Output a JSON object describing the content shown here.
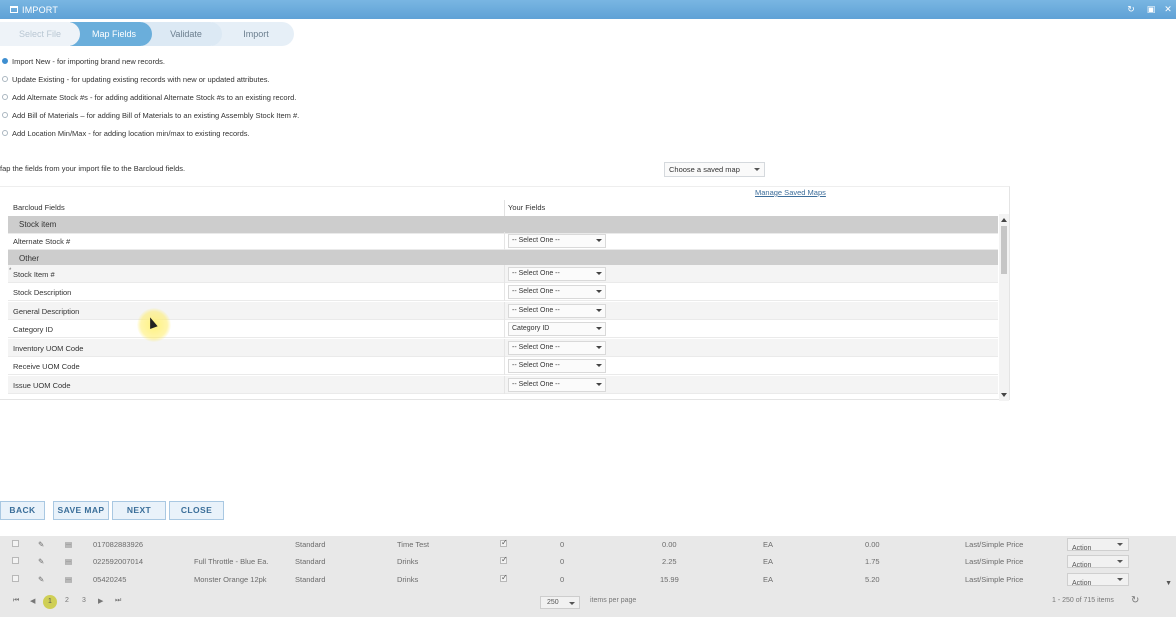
{
  "window": {
    "title": "IMPORT"
  },
  "steps": [
    "Select File",
    "Map Fields",
    "Validate",
    "Import"
  ],
  "options": [
    {
      "label": "Import New - for importing brand new records.",
      "checked": true
    },
    {
      "label": "Update Existing - for updating existing records with new or updated attributes.",
      "checked": false
    },
    {
      "label": "Add Alternate Stock #s - for adding additional Alternate Stock #s to an existing record.",
      "checked": false
    },
    {
      "label": "Add Bill of Materials – for adding Bill of Materials to an existing Assembly Stock Item #.",
      "checked": false
    },
    {
      "label": "Add Location Min/Max - for adding location min/max to existing records.",
      "checked": false
    }
  ],
  "map_instruction": "fap the fields from your import file to the Barcloud fields.",
  "saved_map": "Choose a saved map",
  "manage_link": "Manage Saved Maps",
  "grid": {
    "headers": [
      "Barcloud Fields",
      "Your Fields"
    ],
    "rows": [
      {
        "type": "group",
        "name": "Stock item"
      },
      {
        "type": "field",
        "name": "Alternate Stock #",
        "value": "-- Select One --"
      },
      {
        "type": "group",
        "name": "Other"
      },
      {
        "type": "field",
        "name": "Stock Item #",
        "value": "-- Select One --",
        "required": true
      },
      {
        "type": "field",
        "name": "Stock Description",
        "value": "-- Select One --"
      },
      {
        "type": "field",
        "name": "General Description",
        "value": "-- Select One --"
      },
      {
        "type": "field",
        "name": "Category ID",
        "value": "Category ID"
      },
      {
        "type": "field",
        "name": "Inventory UOM Code",
        "value": "-- Select One --"
      },
      {
        "type": "field",
        "name": "Receive UOM Code",
        "value": "-- Select One --"
      },
      {
        "type": "field",
        "name": "Issue UOM Code",
        "value": "-- Select One --"
      }
    ]
  },
  "buttons": {
    "back": "BACK",
    "save_map": "SAVE MAP",
    "next": "NEXT",
    "close": "CLOSE"
  },
  "background_list": {
    "rows": [
      {
        "code": "017082883926",
        "name": "",
        "type": "Standard",
        "category": "Time Test",
        "qty": "0",
        "price": "0.00",
        "uom": "EA",
        "cost": "0.00",
        "method": "Last/Simple Price",
        "action": "Action"
      },
      {
        "code": "022592007014",
        "name": "Full Throttle - Blue Ea.",
        "type": "Standard",
        "category": "Drinks",
        "qty": "0",
        "price": "2.25",
        "uom": "EA",
        "cost": "1.75",
        "method": "Last/Simple Price",
        "action": "Action"
      },
      {
        "code": "05420245",
        "name": "Monster Orange 12pk",
        "type": "Standard",
        "category": "Drinks",
        "qty": "0",
        "price": "15.99",
        "uom": "EA",
        "cost": "5.20",
        "method": "Last/Simple Price",
        "action": "Action"
      }
    ],
    "pager": {
      "current": "1",
      "pages": [
        "2",
        "3"
      ],
      "per_page": "250",
      "per_page_label": "items per page",
      "summary": "1 - 250 of 715 items"
    }
  }
}
